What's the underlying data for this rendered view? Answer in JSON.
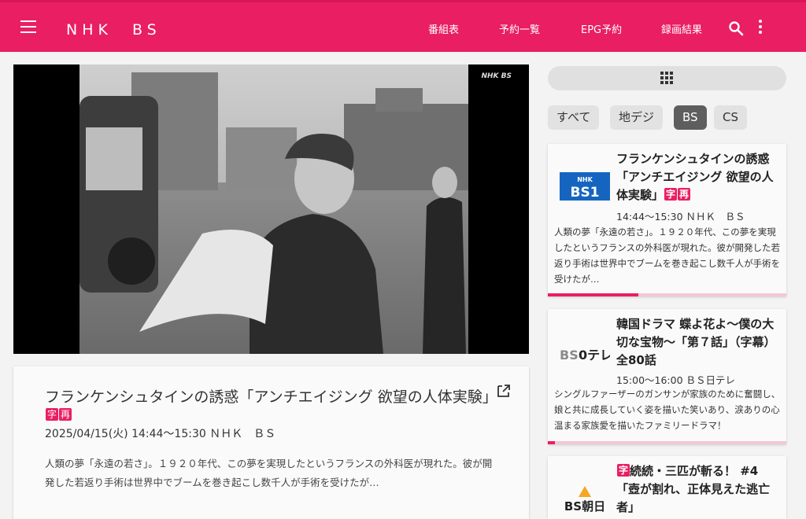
{
  "header": {
    "title": "NHK　BS",
    "nav": [
      "番組表",
      "予約一覧",
      "EPG予約",
      "録画結果"
    ],
    "accent": "#e91e63"
  },
  "player": {
    "channel_logo": "NHK BS"
  },
  "detail": {
    "title": "フランケンシュタインの誘惑「アンチエイジング 欲望の人体実験」",
    "badges": [
      "字",
      "再"
    ],
    "time": "2025/04/15(火) 14:44～15:30  ＮＨＫ　ＢＳ",
    "description": "人類の夢「永遠の若さ」。１９２０年代、この夢を実現したというフランスの外科医が現れた。彼が開発した若返り手術は世界中でブームを巻き起こし数千人が手術を受けたが…"
  },
  "filters": {
    "chips": [
      "すべて",
      "地デジ",
      "BS",
      "CS"
    ],
    "selected": "BS"
  },
  "programs": [
    {
      "logo": "NHK BS1",
      "title": "フランケンシュタインの誘惑「アンチエイジング 欲望の人体実験」",
      "badges": [
        "字",
        "再"
      ],
      "time": "14:44～15:30  ＮＨＫ　ＢＳ",
      "description": "人類の夢「永遠の若さ」。１９２０年代、この夢を実現したというフランスの外科医が現れた。彼が開発した若返り手術は世界中でブームを巻き起こし数千人が手術を受けたが…",
      "progress": 0.38
    },
    {
      "logo": "BS日テレ",
      "title": "韓国ドラマ 蝶よ花よ～僕の大切な宝物～「第７話」（字幕）全80話",
      "badges": [],
      "time": "15:00～16:00  ＢＳ日テレ",
      "description": "シングルファーザーのガンサンが家族のために奮闘し、娘と共に成長していく姿を描いた笑いあり、涙ありの心温まる家族愛を描いたファミリードラマ！",
      "progress": 0.03
    },
    {
      "logo": "BS朝日",
      "title_badge": "字",
      "title": "続続・三匹が斬る！ #4「壺が割れ、正体見えた逃亡者」",
      "time": "",
      "description": "",
      "progress": 0
    }
  ]
}
